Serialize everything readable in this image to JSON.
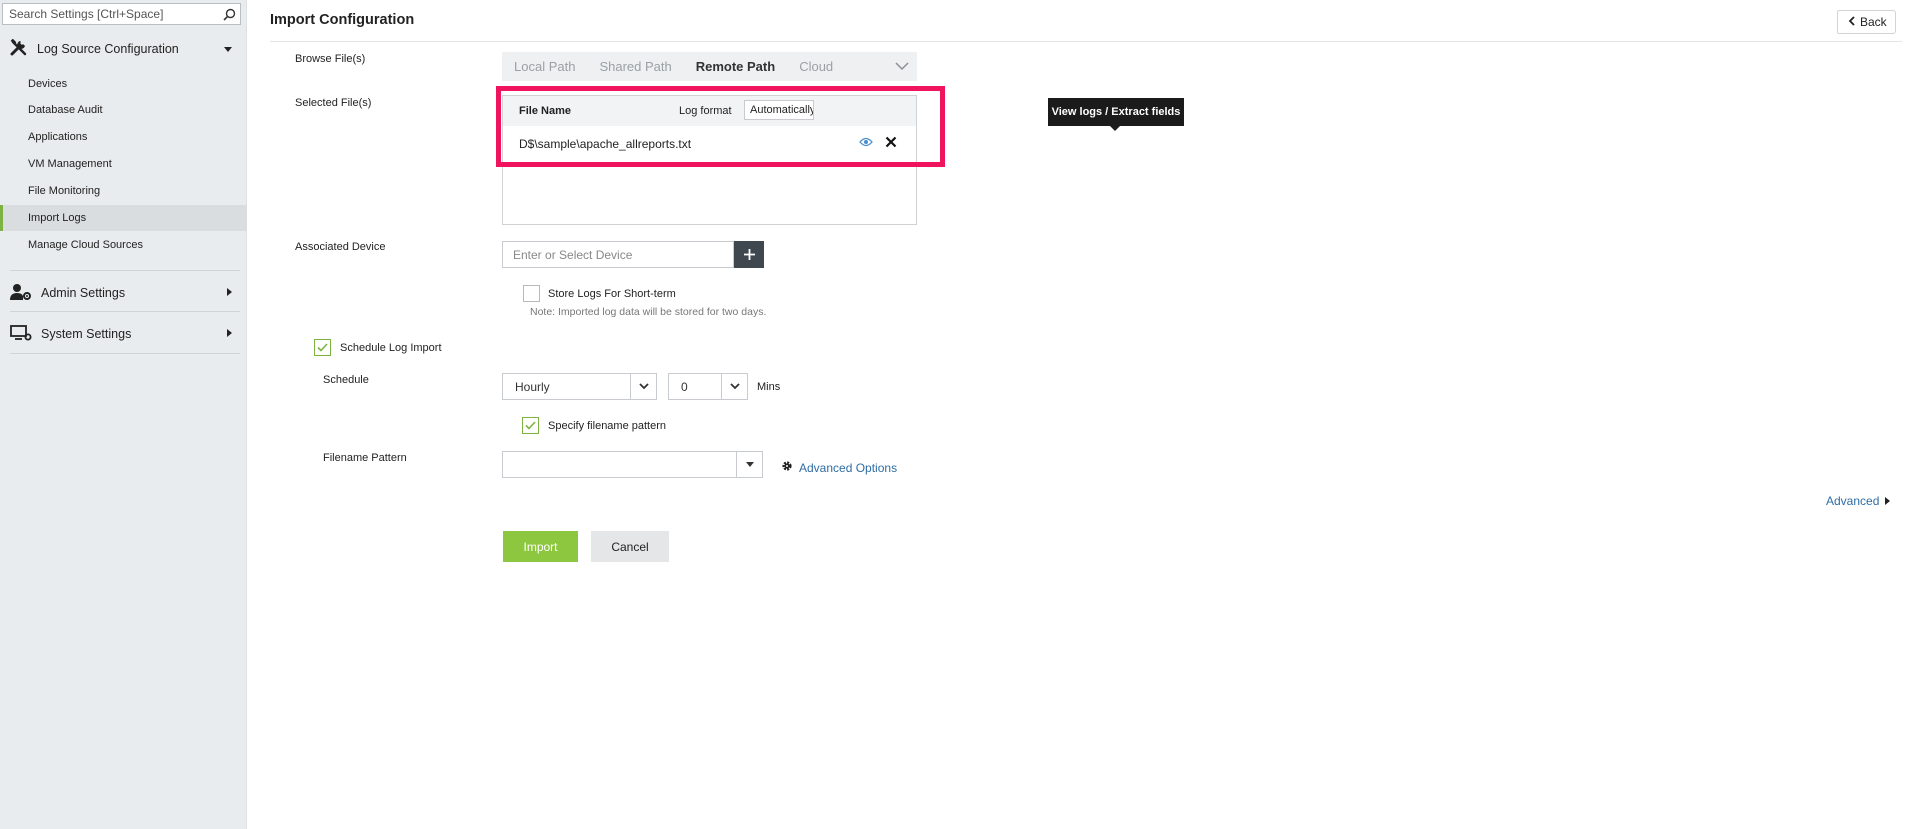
{
  "sidebar": {
    "search_placeholder": "Search Settings [Ctrl+Space]",
    "log_source": {
      "label": "Log Source Configuration",
      "items": [
        {
          "label": "Devices"
        },
        {
          "label": "Database Audit"
        },
        {
          "label": "Applications"
        },
        {
          "label": "VM Management"
        },
        {
          "label": "File Monitoring"
        },
        {
          "label": "Import Logs",
          "active": true
        },
        {
          "label": "Manage Cloud Sources"
        }
      ]
    },
    "admin_settings": "Admin Settings",
    "system_settings": "System Settings"
  },
  "header": {
    "title": "Import Configuration",
    "back_label": "Back"
  },
  "form": {
    "browse_label": "Browse File(s)",
    "tabs": [
      "Local Path",
      "Shared Path",
      "Remote Path",
      "Cloud"
    ],
    "active_tab": "Remote Path",
    "selected_label": "Selected File(s)",
    "files_table": {
      "col_file_name": "File Name",
      "col_log_format": "Log format",
      "log_format_value": "Automatically",
      "rows": [
        {
          "path": "D$\\sample\\apache_allreports.txt"
        }
      ]
    },
    "tooltip": "View logs / Extract fields",
    "device_label": "Associated Device",
    "device_placeholder": "Enter or Select Device",
    "store_logs_label": "Store Logs For Short-term",
    "store_logs_note": "Note: Imported log data will be stored for two days.",
    "schedule_import_label": "Schedule Log Import",
    "schedule_label": "Schedule",
    "schedule_value": "Hourly",
    "mins_value": "0",
    "mins_unit": "Mins",
    "specify_pattern_label": "Specify filename pattern",
    "pattern_label": "Filename Pattern",
    "pattern_value": "",
    "advanced_options": "Advanced Options",
    "advanced": "Advanced",
    "import_button": "Import",
    "cancel_button": "Cancel"
  },
  "colors": {
    "accent_green": "#8dc63f",
    "highlight": "#f0135d",
    "link_blue": "#2e6da4"
  }
}
